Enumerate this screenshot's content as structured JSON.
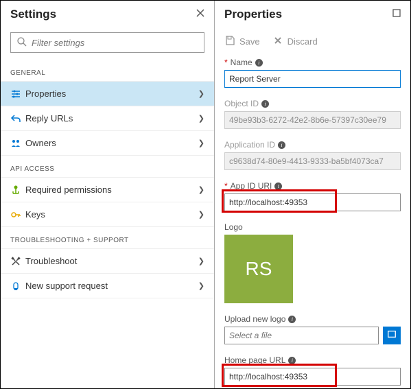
{
  "settings": {
    "title": "Settings",
    "filter_placeholder": "Filter settings",
    "general_label": "GENERAL",
    "api_label": "API ACCESS",
    "support_label": "TROUBLESHOOTING + SUPPORT",
    "items": {
      "properties": "Properties",
      "reply_urls": "Reply URLs",
      "owners": "Owners",
      "required_permissions": "Required permissions",
      "keys": "Keys",
      "troubleshoot": "Troubleshoot",
      "new_support": "New support request"
    }
  },
  "properties": {
    "title": "Properties",
    "actions": {
      "save": "Save",
      "discard": "Discard"
    },
    "fields": {
      "name": {
        "label": "Name",
        "value": "Report Server",
        "required": true
      },
      "object_id": {
        "label": "Object ID",
        "value": "49be93b3-6272-42e2-8b6e-57397c30ee79"
      },
      "application_id": {
        "label": "Application ID",
        "value": "c9638d74-80e9-4413-9333-ba5bf4073ca7"
      },
      "app_id_uri": {
        "label": "App ID URI",
        "value": "http://localhost:49353",
        "required": true
      },
      "logo": {
        "label": "Logo",
        "initials": "RS"
      },
      "upload_logo": {
        "label": "Upload new logo",
        "placeholder": "Select a file"
      },
      "home_page": {
        "label": "Home page URL",
        "value": "http://localhost:49353"
      }
    }
  }
}
